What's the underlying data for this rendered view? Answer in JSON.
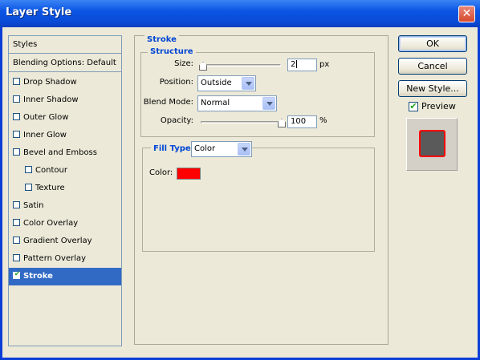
{
  "window": {
    "title": "Layer Style",
    "close_glyph": "✕"
  },
  "sidebar": {
    "header": "Styles",
    "blending": "Blending Options: Default",
    "items": [
      {
        "label": "Drop Shadow",
        "checked": false,
        "indent": false
      },
      {
        "label": "Inner Shadow",
        "checked": false,
        "indent": false
      },
      {
        "label": "Outer Glow",
        "checked": false,
        "indent": false
      },
      {
        "label": "Inner Glow",
        "checked": false,
        "indent": false
      },
      {
        "label": "Bevel and Emboss",
        "checked": false,
        "indent": false
      },
      {
        "label": "Contour",
        "checked": false,
        "indent": true
      },
      {
        "label": "Texture",
        "checked": false,
        "indent": true
      },
      {
        "label": "Satin",
        "checked": false,
        "indent": false
      },
      {
        "label": "Color Overlay",
        "checked": false,
        "indent": false
      },
      {
        "label": "Gradient Overlay",
        "checked": false,
        "indent": false
      },
      {
        "label": "Pattern Overlay",
        "checked": false,
        "indent": false
      },
      {
        "label": "Stroke",
        "checked": true,
        "indent": false,
        "selected": true
      }
    ]
  },
  "stroke": {
    "title": "Stroke",
    "structure_title": "Structure",
    "size_label": "Size:",
    "size_value": "2",
    "size_unit": "px",
    "position_label": "Position:",
    "position_value": "Outside",
    "blend_label": "Blend Mode:",
    "blend_value": "Normal",
    "opacity_label": "Opacity:",
    "opacity_value": "100",
    "opacity_unit": "%",
    "fill_type_label": "Fill Type:",
    "fill_type_value": "Color",
    "color_label": "Color:",
    "color_value": "#ff0000"
  },
  "buttons": {
    "ok": "OK",
    "cancel": "Cancel",
    "new_style": "New Style..."
  },
  "preview": {
    "label": "Preview",
    "checked": true,
    "check_glyph": "✔"
  }
}
